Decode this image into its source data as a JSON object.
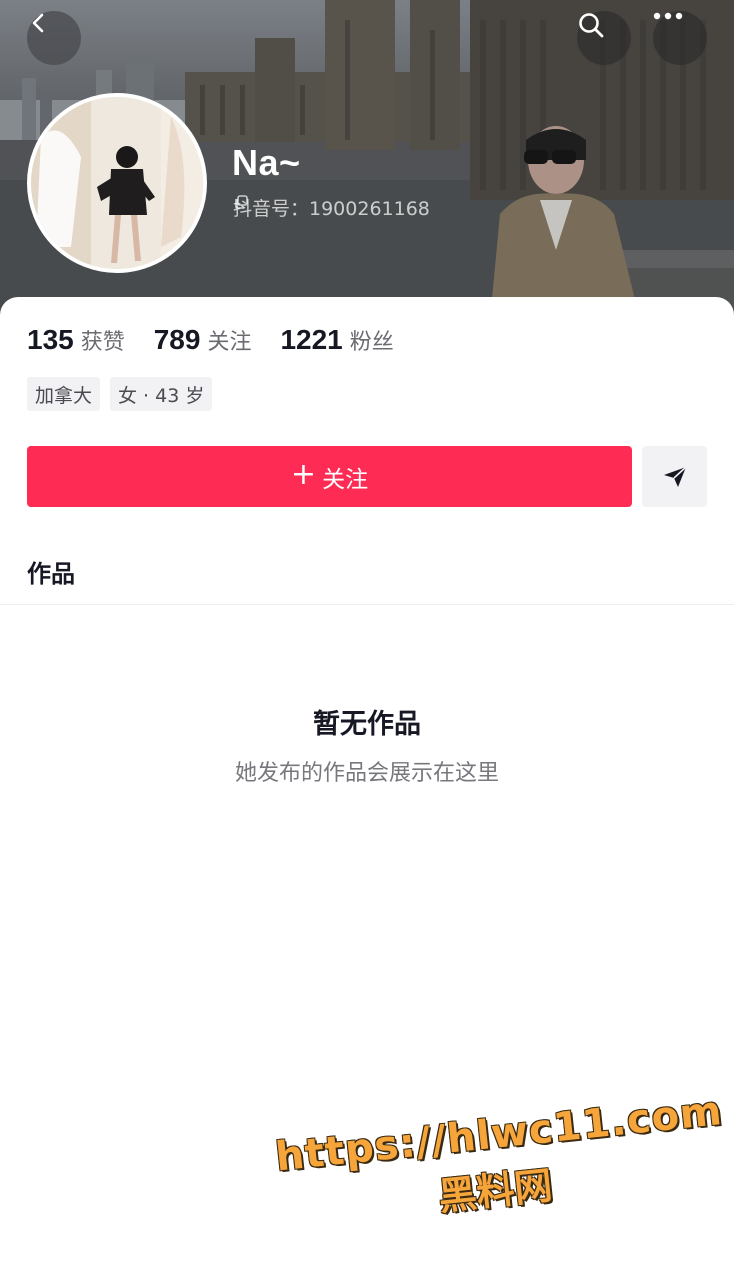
{
  "profile": {
    "nickname": "Na~",
    "douyin_id": "抖音号：1900261168",
    "stats": [
      {
        "value": "135",
        "label": "获赞"
      },
      {
        "value": "789",
        "label": "关注"
      },
      {
        "value": "1221",
        "label": "粉丝"
      }
    ],
    "tags": [
      "加拿大",
      "女 · 43 岁"
    ]
  },
  "actions": {
    "follow_plus": "+",
    "follow_label": "关注"
  },
  "tabs": {
    "works": "作品"
  },
  "empty": {
    "title": "暂无作品",
    "subtitle": "她发布的作品会展示在这里"
  },
  "watermark": {
    "url": "https://hlwc11.com",
    "name": "黑料网"
  },
  "colors": {
    "accent": "#fe2c55",
    "text_primary": "#161823",
    "text_secondary": "#6b6c72"
  },
  "icons": {
    "back": "chevron-left-icon",
    "search": "search-icon",
    "more": "more-horizontal-icon",
    "copy": "copy-icon",
    "share": "send-arrow-icon"
  }
}
